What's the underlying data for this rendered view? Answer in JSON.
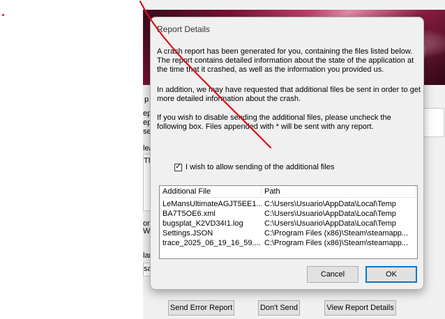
{
  "background_window": {
    "side_letters": [
      "p",
      "ep",
      "ep",
      "se",
      "lea",
      "Th",
      "on",
      "We",
      "lar",
      "sa"
    ],
    "buttons": {
      "send_error_report": "Send Error Report",
      "dont_send": "Don't Send",
      "view_report_details": "View Report Details"
    }
  },
  "dialog": {
    "title": "Report Details",
    "paragraph1": "A crash report has been generated for you, containing the files listed below.  The report contains detailed information about the state of the application at the time that it crashed, as well as the information you provided us.",
    "paragraph2": "In addition, we may have requested that additional files be sent in order to get more detailed information about the crash.",
    "paragraph3": "If you wish to disable sending the additional files, please uncheck the following box.  Files appended with * will be sent with any report.",
    "checkbox": {
      "label": "I wish to allow sending of the additional files",
      "checked": true,
      "mark": "✓"
    },
    "files": {
      "columns": [
        "Additional File",
        "Path"
      ],
      "rows": [
        [
          "LeMansUltimateAGJT5EE1....",
          "C:\\Users\\Usuario\\AppData\\Local\\Temp"
        ],
        [
          "BA7T5OE6.xml",
          "C:\\Users\\Usuario\\AppData\\Local\\Temp"
        ],
        [
          "bugsplat_K2VD34I1.log",
          "C:\\Users\\Usuario\\AppData\\Local\\Temp"
        ],
        [
          "Settings.JSON",
          "C:\\Program Files (x86)\\Steam\\steamapp..."
        ],
        [
          "trace_2025_06_19_16_59....",
          "C:\\Program Files (x86)\\Steam\\steamapp..."
        ]
      ]
    },
    "buttons": {
      "cancel": "Cancel",
      "ok": "OK"
    }
  },
  "colors": {
    "annotation_stroke": "#d6111c",
    "dialog_bg": "#f0f0f0",
    "ok_border": "#0078d7"
  }
}
